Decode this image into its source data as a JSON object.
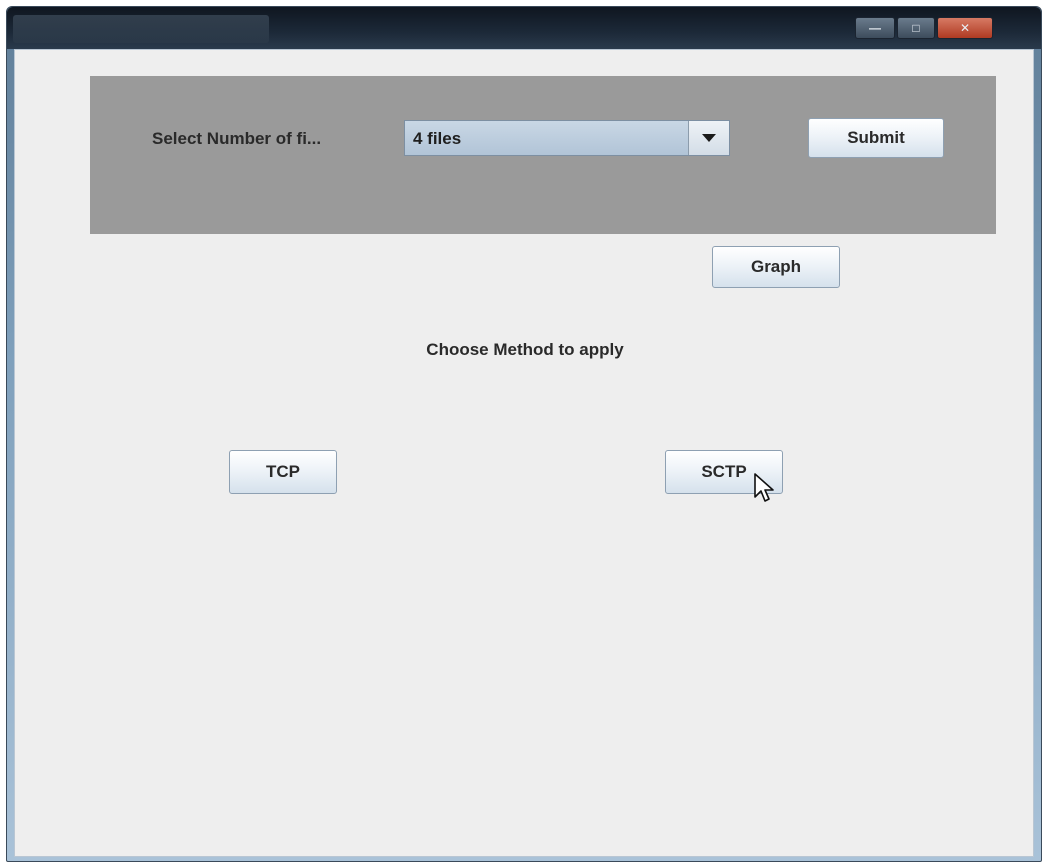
{
  "window": {
    "controls": {
      "minimize_icon": "minimize-icon",
      "maximize_icon": "maximize-icon",
      "close_icon": "close-icon"
    }
  },
  "top_panel": {
    "select_label": "Select Number of fi...",
    "file_count": {
      "selected_value": "4 files"
    },
    "submit_label": "Submit"
  },
  "graph_label": "Graph",
  "method": {
    "heading": "Choose Method to apply",
    "tcp_label": "TCP",
    "sctp_label": "SCTP"
  },
  "colors": {
    "panel_gray": "#9a9a9a",
    "client_background": "#eeeeee",
    "combo_fill": "#b1c4d7",
    "close_button": "#b03a22"
  }
}
